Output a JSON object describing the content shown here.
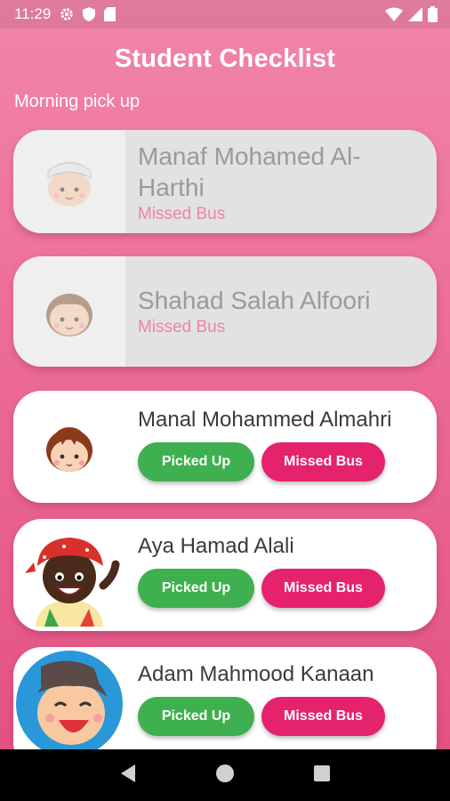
{
  "status_bar": {
    "time": "11:29",
    "left_icons": [
      "gear-icon",
      "shield-icon",
      "sd-card-icon"
    ],
    "right_icons": [
      "wifi-icon",
      "signal-icon",
      "battery-icon"
    ]
  },
  "header": {
    "title": "Student Checklist"
  },
  "section": {
    "label": "Morning pick up"
  },
  "students": [
    {
      "name": "Manaf Mohamed Al-Harthi",
      "status": "Missed Bus",
      "avatar": "boy-cap-avatar"
    },
    {
      "name": "Shahad Salah Alfoori",
      "status": "Missed Bus",
      "avatar": "girl-avatar"
    },
    {
      "name": "Manal Mohammed Almahri",
      "picked_label": "Picked Up",
      "missed_label": "Missed Bus",
      "avatar": "girl-bob-avatar"
    },
    {
      "name": "Aya Hamad Alali",
      "picked_label": "Picked Up",
      "missed_label": "Missed Bus",
      "avatar": "child-bandana-avatar"
    },
    {
      "name": "Adam Mahmood Kanaan",
      "picked_label": "Picked Up",
      "missed_label": "Missed Bus",
      "avatar": "laughing-boy-avatar"
    }
  ],
  "colors": {
    "background_top": "#f186a8",
    "background_bottom": "#e14f81",
    "picked_button": "#3fb04f",
    "missed_button": "#e5236d",
    "missed_status_text": "#f082a8"
  },
  "nav_bar": {
    "icons": [
      "back-icon",
      "home-icon",
      "recents-icon"
    ]
  }
}
